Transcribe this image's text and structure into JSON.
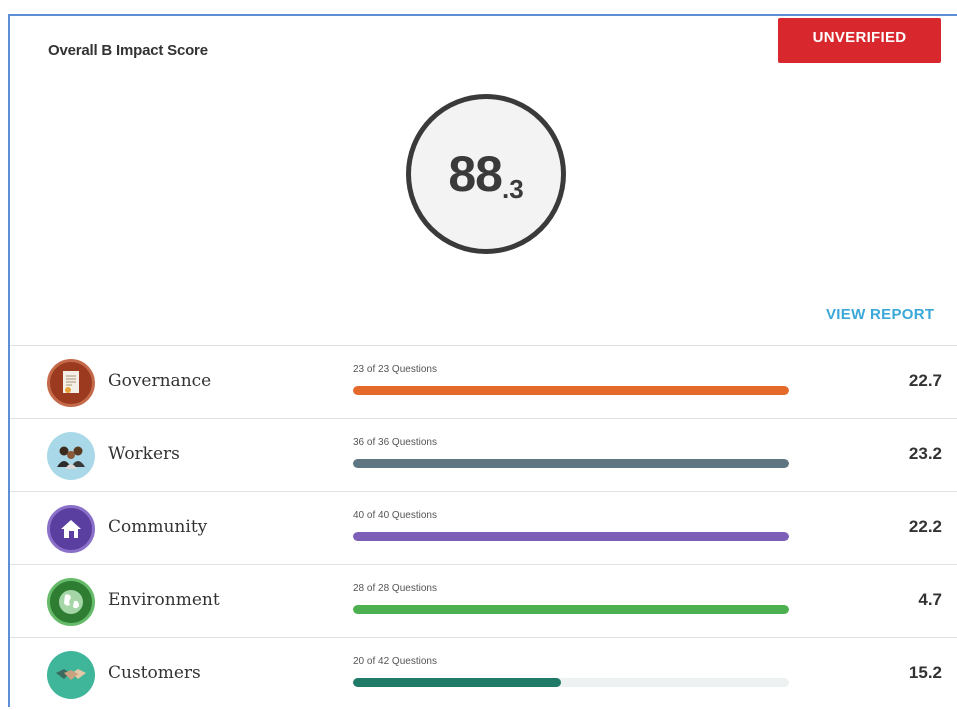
{
  "header": {
    "title": "Overall B Impact Score",
    "status": "UNVERIFIED"
  },
  "score": {
    "main": "88",
    "decimal": ".3"
  },
  "view_report": "VIEW REPORT",
  "categories": [
    {
      "label": "Governance",
      "questions": "23 of 23 Questions",
      "score": "22.7",
      "progress": 1.0,
      "color": "#e5692a",
      "icon": "certificate-icon"
    },
    {
      "label": "Workers",
      "questions": "36 of 36 Questions",
      "score": "23.2",
      "progress": 1.0,
      "color": "#5e7682",
      "icon": "people-icon"
    },
    {
      "label": "Community",
      "questions": "40 of 40 Questions",
      "score": "22.2",
      "progress": 1.0,
      "color": "#7e5fb8",
      "icon": "house-icon"
    },
    {
      "label": "Environment",
      "questions": "28 of 28 Questions",
      "score": "4.7",
      "progress": 1.0,
      "color": "#4caf50",
      "icon": "globe-icon"
    },
    {
      "label": "Customers",
      "questions": "20 of 42 Questions",
      "score": "15.2",
      "progress": 0.476,
      "color": "#1f7a67",
      "icon": "handshake-icon"
    }
  ]
}
